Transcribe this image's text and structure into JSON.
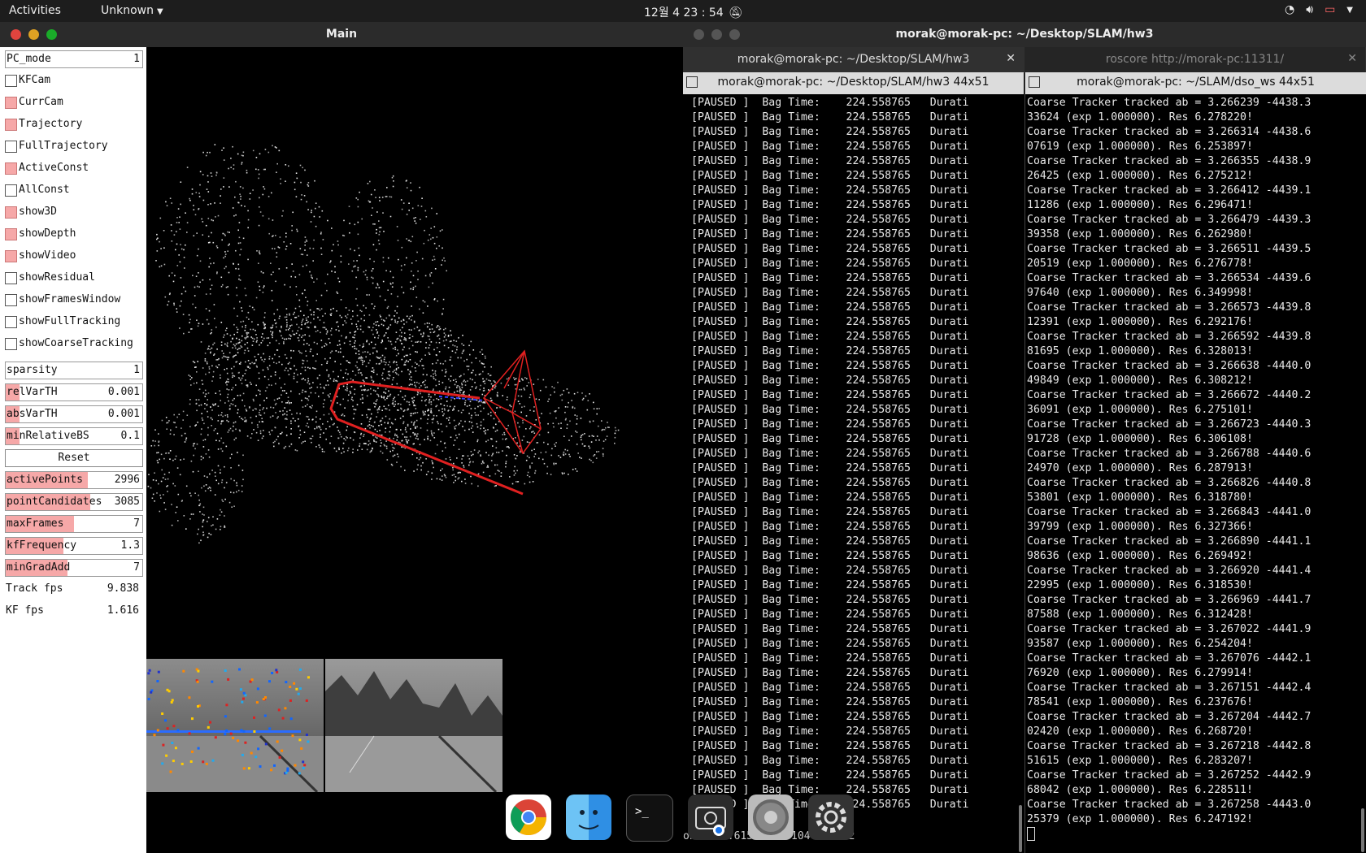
{
  "topbar": {
    "activities": "Activities",
    "app_menu": "Unknown",
    "clock": "12월 4  23 : 54"
  },
  "main_window": {
    "title": "Main",
    "panel": {
      "pc_mode": {
        "label": "PC_mode",
        "value": "1"
      },
      "checkboxes": [
        {
          "label": "KFCam",
          "checked": false
        },
        {
          "label": "CurrCam",
          "checked": true
        },
        {
          "label": "Trajectory",
          "checked": true
        },
        {
          "label": "FullTrajectory",
          "checked": false
        },
        {
          "label": "ActiveConst",
          "checked": true
        },
        {
          "label": "AllConst",
          "checked": false
        },
        {
          "label": "show3D",
          "checked": true
        },
        {
          "label": "showDepth",
          "checked": true
        },
        {
          "label": "showVideo",
          "checked": true
        },
        {
          "label": "showResidual",
          "checked": false
        },
        {
          "label": "showFramesWindow",
          "checked": false
        },
        {
          "label": "showFullTracking",
          "checked": false
        },
        {
          "label": "showCoarseTracking",
          "checked": false
        }
      ],
      "sparsity": {
        "label": "sparsity",
        "value": "1"
      },
      "relVarTH": {
        "label": "relVarTH",
        "value": "0.001",
        "fill": 0.1
      },
      "absVarTH": {
        "label": "absVarTH",
        "value": "0.001",
        "fill": 0.1
      },
      "minRelativeBS": {
        "label": "minRelativeBS",
        "value": "0.1",
        "fill": 0.1
      },
      "reset": "Reset",
      "activePoints": {
        "label": "activePoints",
        "value": "2996",
        "fill": 0.6
      },
      "pointCandidates": {
        "label": "pointCandidates",
        "value": "3085",
        "fill": 0.62
      },
      "maxFrames": {
        "label": "maxFrames",
        "value": "7",
        "fill": 0.5
      },
      "kfFrequency": {
        "label": "kfFrequency",
        "value": "1.3",
        "fill": 0.42
      },
      "minGradAdd": {
        "label": "minGradAdd",
        "value": "7",
        "fill": 0.45
      },
      "track_fps": {
        "label": "Track fps",
        "value": "9.838"
      },
      "kf_fps": {
        "label": "KF fps",
        "value": "1.616"
      }
    }
  },
  "terminal_window": {
    "title": "morak@morak-pc: ~/Desktop/SLAM/hw3",
    "tabs": [
      {
        "label": "morak@morak-pc: ~/Desktop/SLAM/hw3"
      },
      {
        "label": "roscore http://morak-pc:11311/"
      }
    ],
    "left_pane": {
      "header": "morak@morak-pc: ~/Desktop/SLAM/hw3 44x51",
      "line_text": "[PAUSED ]  Bag Time:    224.558765   Durati",
      "status": "on: 102.615171 / 104.000002"
    },
    "right_pane": {
      "header": "morak@morak-pc: ~/SLAM/dso_ws 44x51",
      "lines": [
        "Coarse Tracker tracked ab = 3.266239 -4438.3",
        "33624 (exp 1.000000). Res 6.278220!",
        "Coarse Tracker tracked ab = 3.266314 -4438.6",
        "07619 (exp 1.000000). Res 6.253897!",
        "Coarse Tracker tracked ab = 3.266355 -4438.9",
        "26425 (exp 1.000000). Res 6.275212!",
        "Coarse Tracker tracked ab = 3.266412 -4439.1",
        "11286 (exp 1.000000). Res 6.296471!",
        "Coarse Tracker tracked ab = 3.266479 -4439.3",
        "39358 (exp 1.000000). Res 6.262980!",
        "Coarse Tracker tracked ab = 3.266511 -4439.5",
        "20519 (exp 1.000000). Res 6.276778!",
        "Coarse Tracker tracked ab = 3.266534 -4439.6",
        "97640 (exp 1.000000). Res 6.349998!",
        "Coarse Tracker tracked ab = 3.266573 -4439.8",
        "12391 (exp 1.000000). Res 6.292176!",
        "Coarse Tracker tracked ab = 3.266592 -4439.8",
        "81695 (exp 1.000000). Res 6.328013!",
        "Coarse Tracker tracked ab = 3.266638 -4440.0",
        "49849 (exp 1.000000). Res 6.308212!",
        "Coarse Tracker tracked ab = 3.266672 -4440.2",
        "36091 (exp 1.000000). Res 6.275101!",
        "Coarse Tracker tracked ab = 3.266723 -4440.3",
        "91728 (exp 1.000000). Res 6.306108!",
        "Coarse Tracker tracked ab = 3.266788 -4440.6",
        "24970 (exp 1.000000). Res 6.287913!",
        "Coarse Tracker tracked ab = 3.266826 -4440.8",
        "53801 (exp 1.000000). Res 6.318780!",
        "Coarse Tracker tracked ab = 3.266843 -4441.0",
        "39799 (exp 1.000000). Res 6.327366!",
        "Coarse Tracker tracked ab = 3.266890 -4441.1",
        "98636 (exp 1.000000). Res 6.269492!",
        "Coarse Tracker tracked ab = 3.266920 -4441.4",
        "22995 (exp 1.000000). Res 6.318530!",
        "Coarse Tracker tracked ab = 3.266969 -4441.7",
        "87588 (exp 1.000000). Res 6.312428!",
        "Coarse Tracker tracked ab = 3.267022 -4441.9",
        "93587 (exp 1.000000). Res 6.254204!",
        "Coarse Tracker tracked ab = 3.267076 -4442.1",
        "76920 (exp 1.000000). Res 6.279914!",
        "Coarse Tracker tracked ab = 3.267151 -4442.4",
        "78541 (exp 1.000000). Res 6.237676!",
        "Coarse Tracker tracked ab = 3.267204 -4442.7",
        "02420 (exp 1.000000). Res 6.268720!",
        "Coarse Tracker tracked ab = 3.267218 -4442.8",
        "51615 (exp 1.000000). Res 6.283207!",
        "Coarse Tracker tracked ab = 3.267252 -4442.9",
        "68042 (exp 1.000000). Res 6.228511!",
        "Coarse Tracker tracked ab = 3.267258 -4443.0",
        "25379 (exp 1.000000). Res 6.247192!"
      ]
    }
  },
  "dock": [
    "chrome-icon",
    "finder-icon",
    "terminal-icon",
    "screenshot-icon",
    "settings-icon",
    "gear-icon"
  ],
  "colors": {
    "accent_red": "#e02020",
    "check_fill": "#f6a8a8",
    "topbar": "#1d1d1d"
  }
}
